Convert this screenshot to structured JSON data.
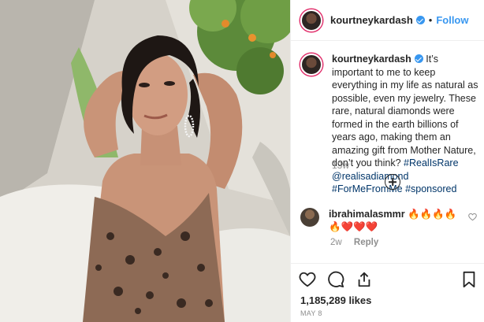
{
  "post": {
    "author": "kourtneykardash",
    "follow_label": "Follow",
    "separator": "•",
    "caption_text": "It’s important to me to keep everything in my life as natural as possible, even my jewelry. These rare, natural diamonds were formed in the earth billions of years ago, making them an amazing gift from Mother Nature, don’t you think?",
    "hashtags": "#RealIsRare @realisadiamond #ForMeFromMe #sponsored",
    "caption_time": "13w",
    "likes": "1,185,289 likes",
    "date": "MAY 8"
  },
  "comment": {
    "username": "ibrahimalasmmr",
    "text": "🔥🔥🔥🔥🔥❤️❤️❤️",
    "time": "2w",
    "reply_label": "Reply"
  },
  "colors": {
    "link_blue": "#3897f0",
    "hashtag_blue": "#003569",
    "muted": "#8e8e8e",
    "text": "#262626"
  },
  "icons": [
    "verified-badge-icon",
    "plus-circle-icon",
    "heart-icon",
    "comment-icon",
    "share-icon",
    "bookmark-icon"
  ]
}
